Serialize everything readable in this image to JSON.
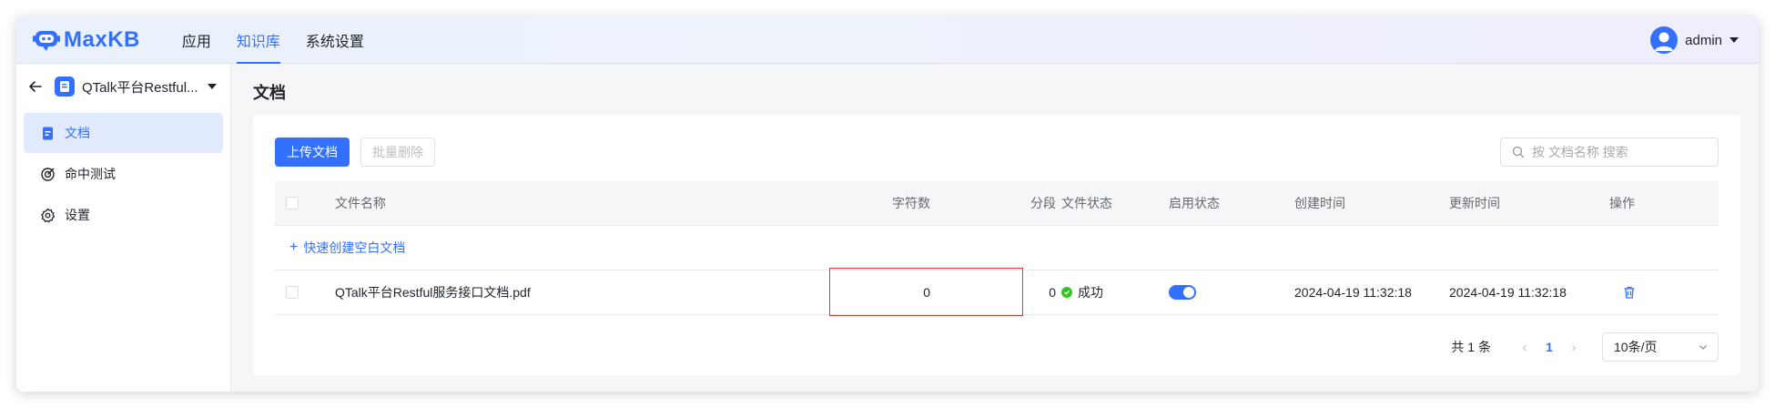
{
  "header": {
    "logo_text": "MaxKB",
    "nav": [
      {
        "label": "应用",
        "active": false
      },
      {
        "label": "知识库",
        "active": true
      },
      {
        "label": "系统设置",
        "active": false
      }
    ],
    "user": "admin"
  },
  "sidebar": {
    "kb_name": "QTalk平台Restful...",
    "items": [
      {
        "label": "文档",
        "icon": "document-icon",
        "active": true
      },
      {
        "label": "命中测试",
        "icon": "target-icon",
        "active": false
      },
      {
        "label": "设置",
        "icon": "gear-icon",
        "active": false
      }
    ]
  },
  "main": {
    "title": "文档",
    "upload_label": "上传文档",
    "batch_delete_label": "批量删除",
    "search_placeholder": "按 文档名称 搜索",
    "columns": {
      "name": "文件名称",
      "chars": "字符数",
      "segments": "分段",
      "status": "文件状态",
      "enabled": "启用状态",
      "created": "创建时间",
      "updated": "更新时间",
      "actions": "操作"
    },
    "quick_create_label": "快速创建空白文档",
    "rows": [
      {
        "name": "QTalk平台Restful服务接口文档.pdf",
        "chars": "0",
        "segments": "0",
        "status": "成功",
        "enabled": true,
        "created": "2024-04-19 11:32:18",
        "updated": "2024-04-19 11:32:18"
      }
    ],
    "pagination": {
      "total": "共 1 条",
      "current_page": "1",
      "page_size": "10条/页"
    }
  },
  "colors": {
    "accent": "#3370ff",
    "success": "#34c724",
    "highlight": "#e8363d"
  }
}
